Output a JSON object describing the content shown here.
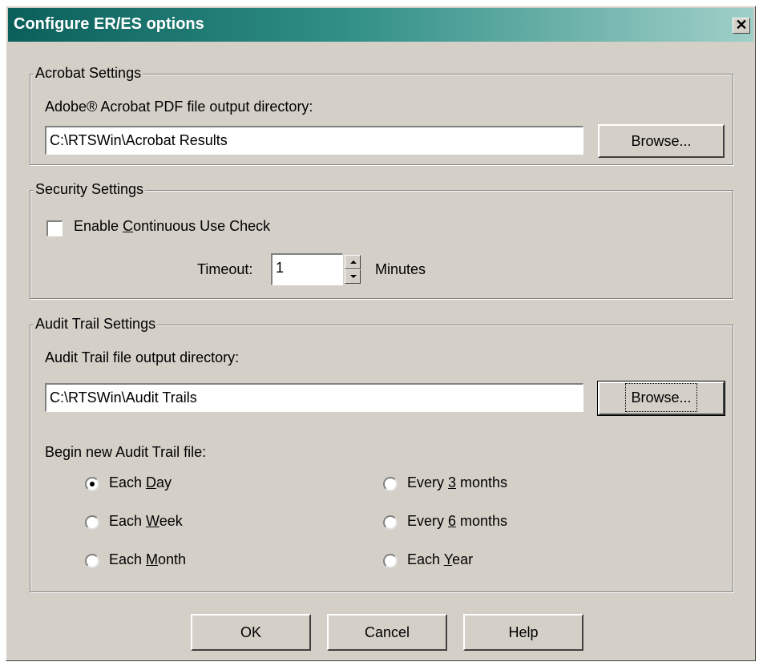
{
  "window": {
    "title": "Configure ER/ES options",
    "close_glyph": "✕"
  },
  "acrobat": {
    "legend": "Acrobat Settings",
    "dir_label": "Adobe® Acrobat PDF file output directory:",
    "dir_value": "C:\\RTSWin\\Acrobat Results",
    "browse_label": "Browse..."
  },
  "security": {
    "legend": "Security Settings",
    "continuous_label": {
      "pre": "Enable ",
      "key": "C",
      "post": "ontinuous Use Check"
    },
    "continuous_checked": false,
    "timeout_label": "Timeout:",
    "timeout_value": "1",
    "minutes_label": "Minutes"
  },
  "audit": {
    "legend": "Audit Trail Settings",
    "dir_label": "Audit Trail file output directory:",
    "dir_value": "C:\\RTSWin\\Audit Trails",
    "browse_label": "Browse...",
    "begin_label": "Begin new Audit Trail file:",
    "options": [
      {
        "pre": "Each ",
        "key": "D",
        "post": "ay",
        "checked": true
      },
      {
        "pre": "Each ",
        "key": "W",
        "post": "eek",
        "checked": false
      },
      {
        "pre": "Each ",
        "key": "M",
        "post": "onth",
        "checked": false
      },
      {
        "pre": "Every ",
        "key": "3",
        "post": " months",
        "checked": false
      },
      {
        "pre": "Every ",
        "key": "6",
        "post": " months",
        "checked": false
      },
      {
        "pre": "Each ",
        "key": "Y",
        "post": "ear",
        "checked": false
      }
    ]
  },
  "buttons": {
    "ok": "OK",
    "cancel": "Cancel",
    "help": "Help"
  },
  "icons": {
    "close": "close-icon",
    "spin_up": "spin-up-icon",
    "spin_down": "spin-down-icon"
  }
}
